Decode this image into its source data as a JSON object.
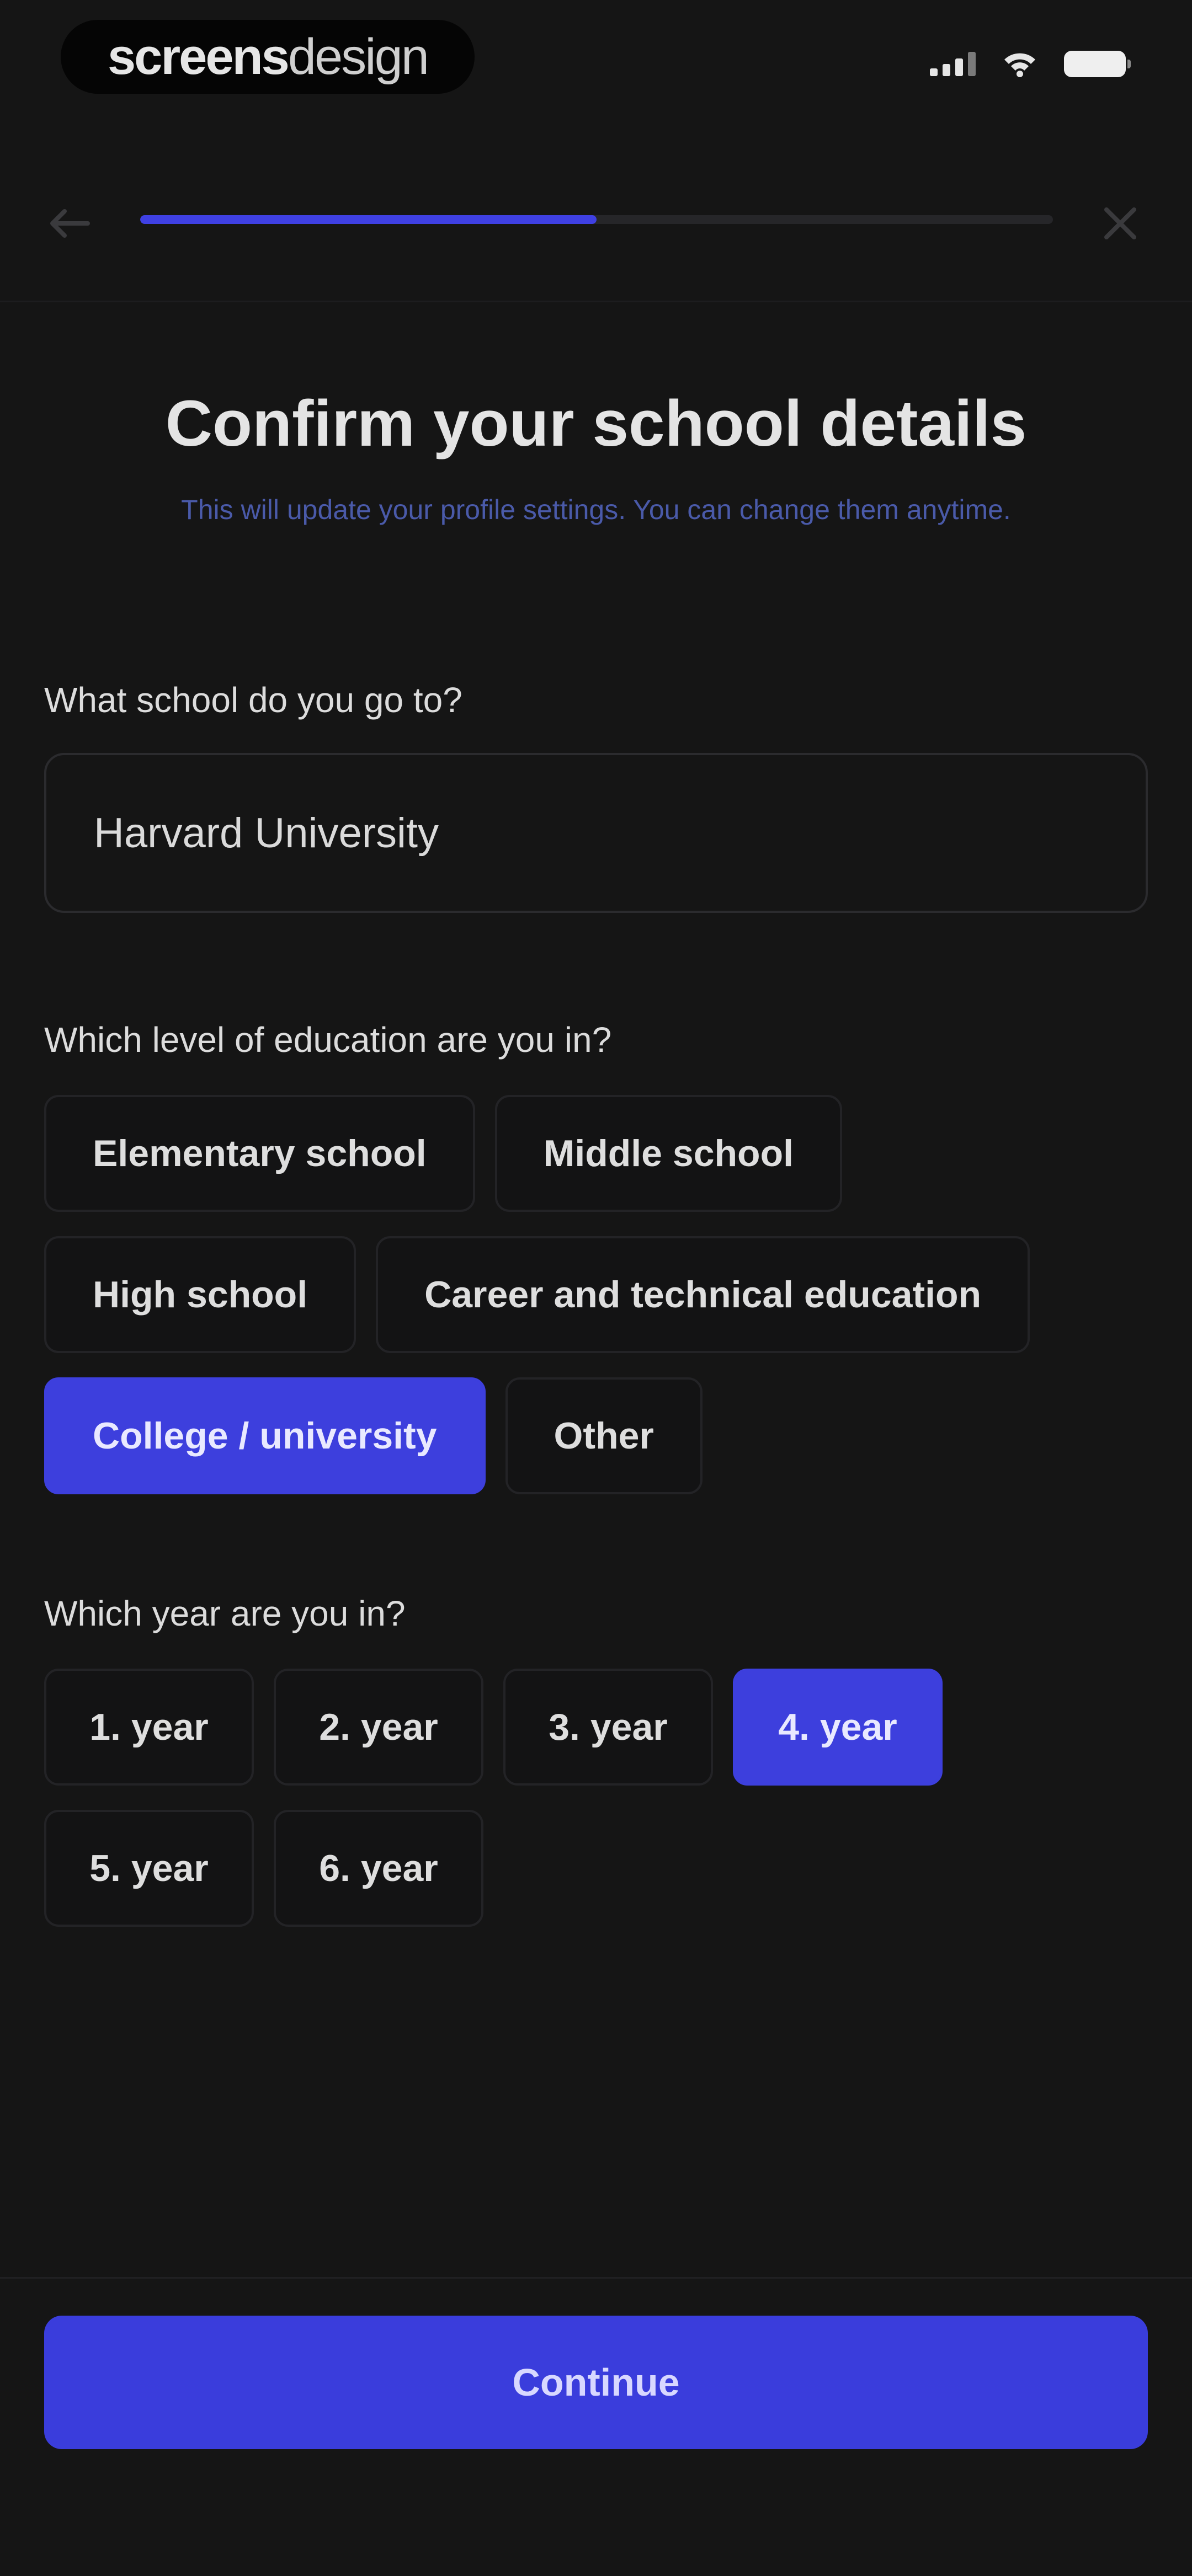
{
  "status_bar": {
    "logo_part1": "screens",
    "logo_part2": "design",
    "icons": [
      "signal-icon",
      "wifi-icon",
      "battery-icon"
    ]
  },
  "header": {
    "back_icon": "arrow-left-icon",
    "close_icon": "close-icon",
    "progress_fraction": 0.5
  },
  "title": "Confirm your school details",
  "subtitle": "This will update your profile settings. You can change them anytime.",
  "school": {
    "label": "What school do you go to?",
    "value": "Harvard University"
  },
  "education": {
    "label": "Which level of education are you in?",
    "options": [
      {
        "label": "Elementary school",
        "selected": false
      },
      {
        "label": "Middle school",
        "selected": false
      },
      {
        "label": "High school",
        "selected": false
      },
      {
        "label": "Career and technical education",
        "selected": false
      },
      {
        "label": "College / university",
        "selected": true
      },
      {
        "label": "Other",
        "selected": false
      }
    ]
  },
  "year": {
    "label": "Which year are you in?",
    "options": [
      {
        "label": "1. year",
        "selected": false
      },
      {
        "label": "2. year",
        "selected": false
      },
      {
        "label": "3. year",
        "selected": false
      },
      {
        "label": "4. year",
        "selected": true
      },
      {
        "label": "5. year",
        "selected": false
      },
      {
        "label": "6. year",
        "selected": false
      }
    ]
  },
  "continue_label": "Continue",
  "colors": {
    "accent": "#3d3fdd",
    "background": "#151515",
    "subtitle": "#4a5aa9"
  }
}
